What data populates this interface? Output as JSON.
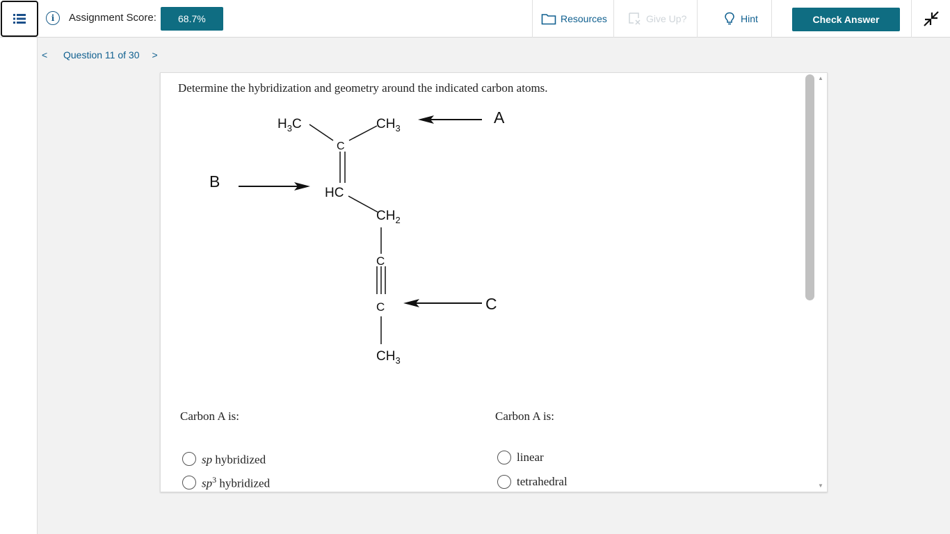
{
  "header": {
    "score_label": "Assignment Score:",
    "score_value": "68.7%",
    "resources_label": "Resources",
    "giveup_label": "Give Up?",
    "hint_label": "Hint",
    "check_label": "Check Answer"
  },
  "nav": {
    "question_label": "Question 11 of 30",
    "prev": "<",
    "next": ">"
  },
  "question": {
    "prompt": "Determine the hybridization and geometry around the indicated carbon atoms.",
    "molecule": {
      "h3c_left": "H",
      "h3c_left_sub": "3",
      "h3c_left_c": "C",
      "ch3_top": "CH",
      "ch3_top_sub": "3",
      "c_center": "C",
      "hc": "HC",
      "ch2": "CH",
      "ch2_sub": "2",
      "c_triple_top": "C",
      "c_triple_bottom": "C",
      "ch3_bottom": "CH",
      "ch3_bottom_sub": "3",
      "label_a": "A",
      "label_b": "B",
      "label_c": "C"
    },
    "left_column": {
      "label": "Carbon A is:",
      "options": [
        {
          "prefix": "sp",
          "sup": "",
          "suffix": " hybridized"
        },
        {
          "prefix": "sp",
          "sup": "3",
          "suffix": " hybridized"
        }
      ]
    },
    "right_column": {
      "label": "Carbon A is:",
      "options": [
        {
          "text": "linear"
        },
        {
          "text": "tetrahedral"
        }
      ]
    }
  },
  "colors": {
    "accent": "#0f6d82",
    "link": "#0f5f8f",
    "disabled": "#cfd5da"
  },
  "icons": {
    "menu": "list-icon",
    "info": "info-icon",
    "resources": "folder-icon",
    "giveup": "give-up-icon",
    "hint": "lightbulb-icon",
    "collapse": "collapse-arrows-icon"
  }
}
